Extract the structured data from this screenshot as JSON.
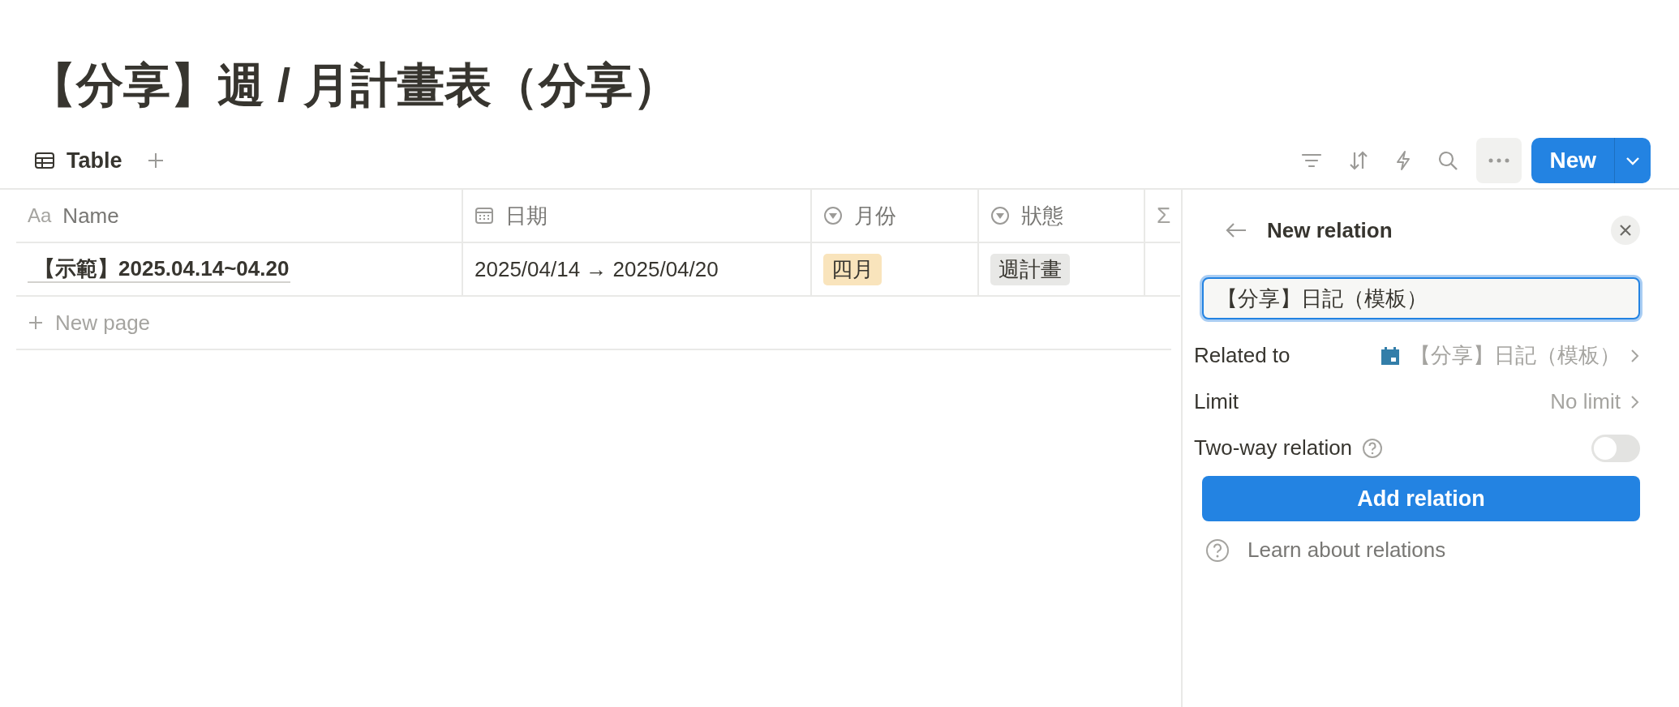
{
  "page": {
    "title": "【分享】週 / 月計畫表（分享）"
  },
  "view_tabs": [
    {
      "label": "Table",
      "selected": true
    }
  ],
  "toolbar": {
    "new_button": "New"
  },
  "table": {
    "columns": [
      {
        "label": "Name",
        "kind": "title",
        "icon_text": "Aa"
      },
      {
        "label": "日期",
        "kind": "date"
      },
      {
        "label": "月份",
        "kind": "select"
      },
      {
        "label": "狀態",
        "kind": "select"
      },
      {
        "kind": "formula",
        "icon_text": "Σ"
      }
    ],
    "rows": [
      {
        "name": "【示範】2025.04.14~04.20",
        "date": "2025/04/14 → 2025/04/20",
        "tags": [
          {
            "label": "四月",
            "color": "#f9e4bc"
          },
          {
            "label": "週計畫",
            "color": "#e8e8e6"
          }
        ]
      }
    ],
    "new_page": "New page"
  },
  "panel": {
    "title": "New relation",
    "input_value": "【分享】日記（模板）",
    "settings": [
      {
        "kind": "database_link",
        "label": "Related to",
        "value": "【分享】日記（模板）"
      },
      {
        "kind": "link",
        "label": "Limit",
        "value": "No limit"
      },
      {
        "kind": "toggle",
        "label": "Two-way relation",
        "on": false
      }
    ],
    "submit": "Add relation",
    "help_link": "Learn about relations"
  }
}
